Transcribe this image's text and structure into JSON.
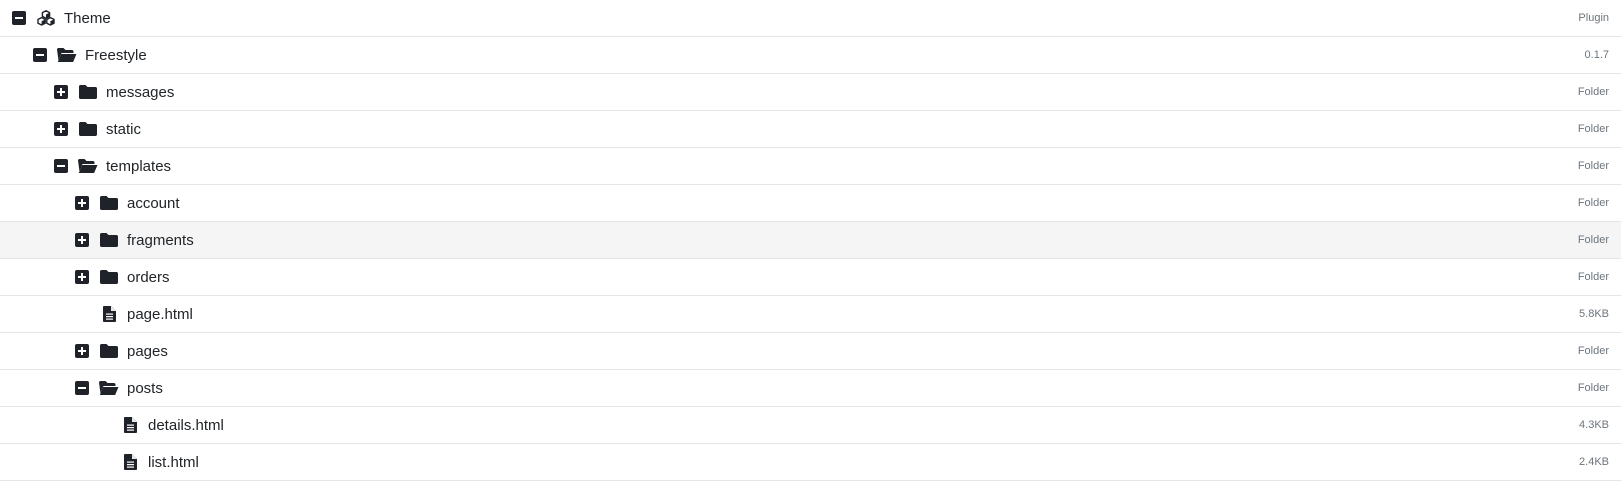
{
  "tree": [
    {
      "label": "Theme",
      "meta": "Plugin",
      "icon": "cubes-icon",
      "depth": 0,
      "toggle": "collapse"
    },
    {
      "label": "Freestyle",
      "meta": "0.1.7",
      "icon": "folder-open-icon",
      "depth": 1,
      "toggle": "collapse"
    },
    {
      "label": "messages",
      "meta": "Folder",
      "icon": "folder-icon",
      "depth": 2,
      "toggle": "expand"
    },
    {
      "label": "static",
      "meta": "Folder",
      "icon": "folder-icon",
      "depth": 2,
      "toggle": "expand"
    },
    {
      "label": "templates",
      "meta": "Folder",
      "icon": "folder-open-icon",
      "depth": 2,
      "toggle": "collapse"
    },
    {
      "label": "account",
      "meta": "Folder",
      "icon": "folder-icon",
      "depth": 3,
      "toggle": "expand"
    },
    {
      "label": "fragments",
      "meta": "Folder",
      "icon": "folder-icon",
      "depth": 3,
      "toggle": "expand",
      "hover": true
    },
    {
      "label": "orders",
      "meta": "Folder",
      "icon": "folder-icon",
      "depth": 3,
      "toggle": "expand"
    },
    {
      "label": "page.html",
      "meta": "5.8KB",
      "icon": "file-icon",
      "depth": 3,
      "toggle": "none"
    },
    {
      "label": "pages",
      "meta": "Folder",
      "icon": "folder-icon",
      "depth": 3,
      "toggle": "expand"
    },
    {
      "label": "posts",
      "meta": "Folder",
      "icon": "folder-open-icon",
      "depth": 3,
      "toggle": "collapse"
    },
    {
      "label": "details.html",
      "meta": "4.3KB",
      "icon": "file-icon",
      "depth": 4,
      "toggle": "none"
    },
    {
      "label": "list.html",
      "meta": "2.4KB",
      "icon": "file-icon",
      "depth": 4,
      "toggle": "none"
    }
  ],
  "colors": {
    "icon": "#1f2329",
    "text": "#212529",
    "meta": "#6c757d",
    "border": "#e4e6ea",
    "hover": "#f5f5f5"
  }
}
